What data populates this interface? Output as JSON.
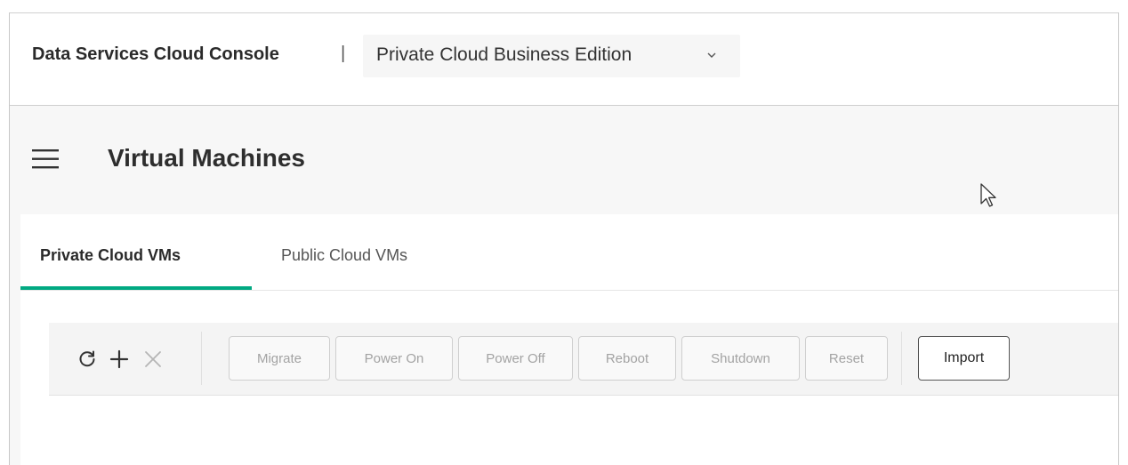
{
  "header": {
    "brand": "Data Services Cloud Console",
    "separator": "|",
    "edition_label": "Private Cloud Business Edition"
  },
  "page": {
    "title": "Virtual Machines"
  },
  "tabs": [
    {
      "label": "Private Cloud VMs",
      "active": true
    },
    {
      "label": "Public Cloud VMs",
      "active": false
    }
  ],
  "toolbar": {
    "icons": [
      "refresh-icon",
      "add-icon",
      "delete-icon"
    ],
    "buttons": [
      {
        "label": "Migrate",
        "enabled": false
      },
      {
        "label": "Power On",
        "enabled": false
      },
      {
        "label": "Power Off",
        "enabled": false
      },
      {
        "label": "Reboot",
        "enabled": false
      },
      {
        "label": "Shutdown",
        "enabled": false
      },
      {
        "label": "Reset",
        "enabled": false
      },
      {
        "label": "Import",
        "enabled": true
      }
    ]
  },
  "colors": {
    "accent": "#01a982",
    "disabled_text": "#a3a3a3",
    "page_background": "#f7f7f7"
  }
}
